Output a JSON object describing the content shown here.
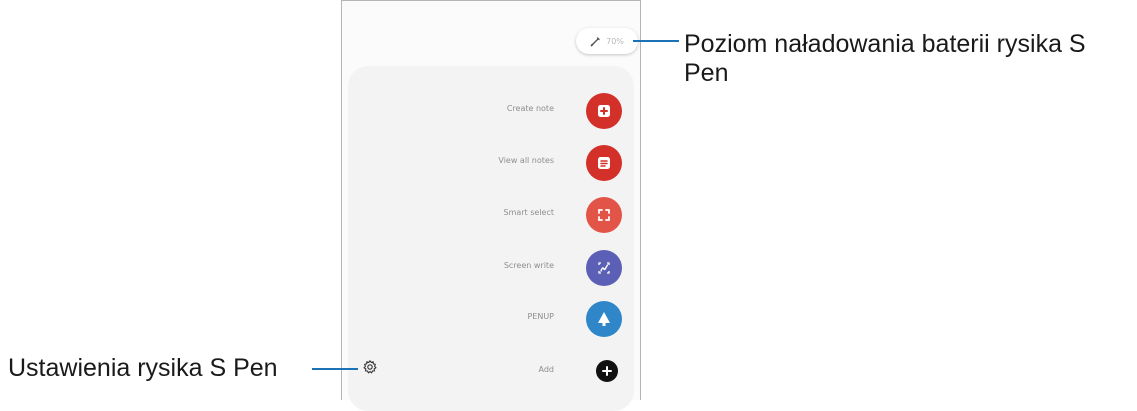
{
  "battery": {
    "percent": "70%"
  },
  "menu": {
    "items": [
      {
        "label": "Create note",
        "icon": "create-note-icon",
        "color": "#d3302a"
      },
      {
        "label": "View all notes",
        "icon": "view-all-notes-icon",
        "color": "#d3302a"
      },
      {
        "label": "Smart select",
        "icon": "smart-select-icon",
        "color": "#e35448"
      },
      {
        "label": "Screen write",
        "icon": "screen-write-icon",
        "color": "#5c5fb6"
      },
      {
        "label": "PENUP",
        "icon": "penup-icon",
        "color": "#2f86c9"
      },
      {
        "label": "Add",
        "icon": "add-icon",
        "color": "#111111"
      }
    ]
  },
  "callouts": {
    "battery": "Poziom naładowania baterii rysika S Pen",
    "settings": "Ustawienia rysika S Pen"
  }
}
